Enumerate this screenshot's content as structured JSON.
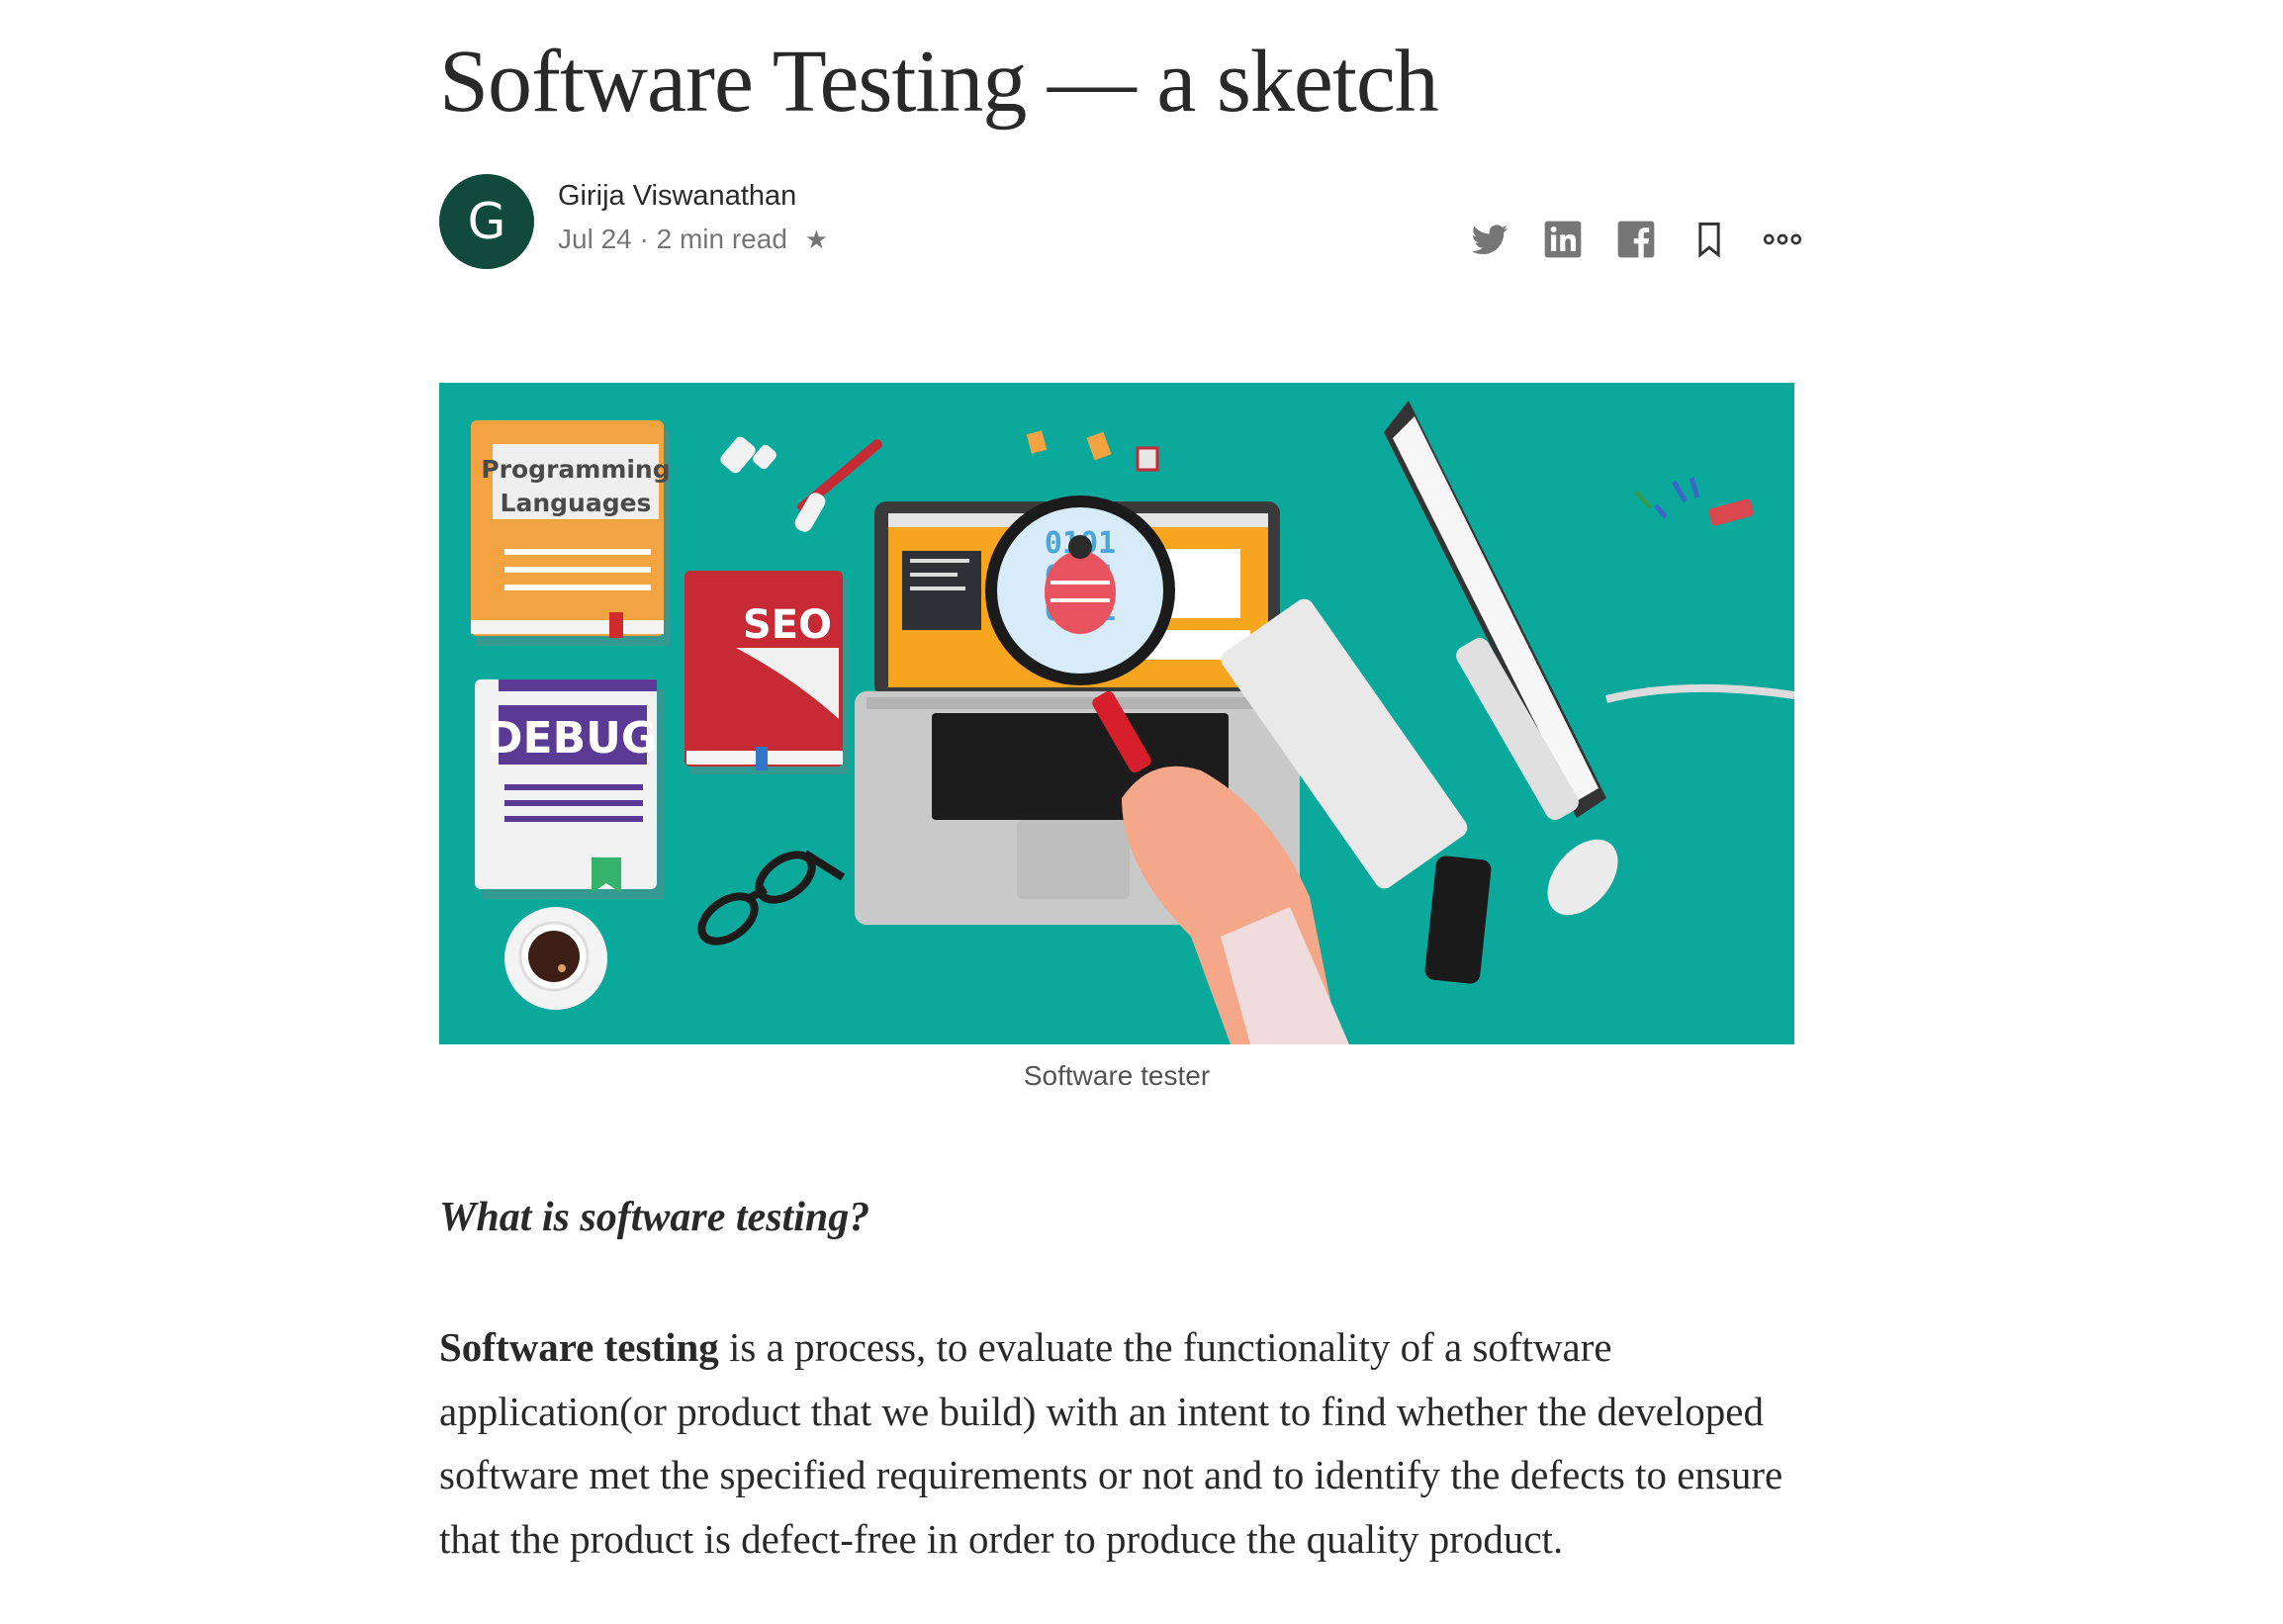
{
  "article": {
    "title": "Software Testing — a sketch",
    "author": {
      "initial": "G",
      "name": "Girija Viswanathan",
      "date": "Jul 24",
      "separator": "·",
      "read_time": "2 min read",
      "star": "★"
    },
    "share_icons": [
      "twitter-icon",
      "linkedin-icon",
      "facebook-icon",
      "bookmark-icon",
      "more-icon"
    ],
    "figure": {
      "caption": "Software tester",
      "labels": {
        "book1": "Programming",
        "book1_line2": "Languages",
        "book2": "SEO",
        "book3": "DEBUG",
        "binary": "0101"
      }
    },
    "subheading": "What is software testing?",
    "paragraph": {
      "bold": "Software testing",
      "text": " is a process, to evaluate the functionality of a software application(or product that we build) with an intent to find whether the developed software met the specified requirements or not and to identify the defects to ensure that the product is defect-free in order to produce the quality product."
    }
  },
  "colors": {
    "avatar_bg": "#0f4a3b",
    "figure_bg": "#0ba89c",
    "icon": "#767676"
  }
}
